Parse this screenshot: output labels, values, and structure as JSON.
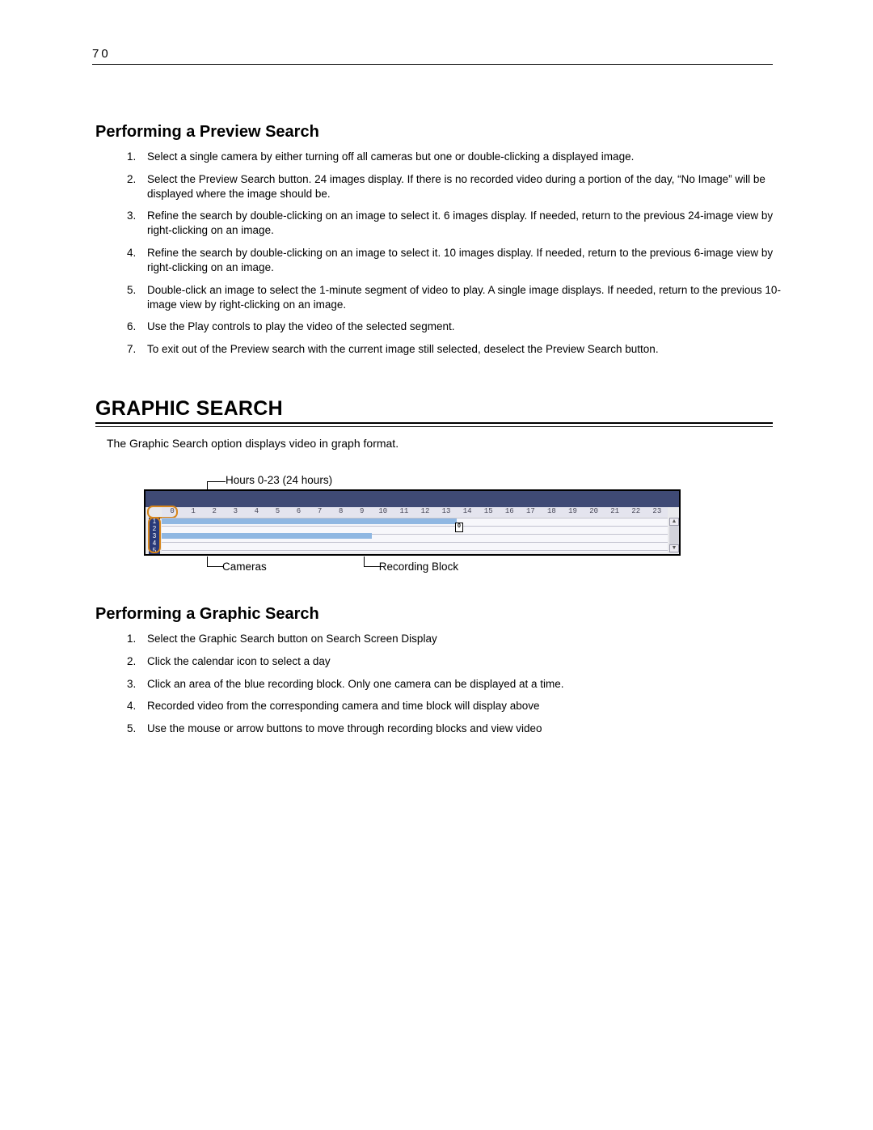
{
  "page_number": "70",
  "sections": {
    "preview": {
      "heading": "Performing a Preview Search",
      "steps": [
        "Select a single camera by either turning off all cameras but one or double-clicking a displayed image.",
        "Select the Preview Search button.  24 images display.  If there is no recorded video during a portion of the day, “No Image” will be displayed where the image should be.",
        "Refine the search by double-clicking on an image to select it.  6 images display. If needed, return to the previous 24-image view by right-clicking on an image.",
        "Refine the search by double-clicking on an image to select it.  10 images display. If needed, return to the previous 6-image view by right-clicking on an image.",
        "Double-click an image to select the 1-minute segment of video to play.  A single image displays.  If needed, return to the previous 10-image view by right-clicking on an image.",
        "Use the Play controls to play the video of the selected segment.",
        "To exit out of the Preview search with the current image still selected, deselect the Preview Search button."
      ]
    },
    "graphic": {
      "heading": "GRAPHIC SEARCH",
      "intro": "The Graphic Search option displays video in graph format.",
      "annotations": {
        "hours": "Hours 0-23 (24 hours)",
        "cameras": "Cameras",
        "recording_block": "Recording Block"
      },
      "hours": [
        "0",
        "1",
        "2",
        "3",
        "4",
        "5",
        "6",
        "7",
        "8",
        "9",
        "10",
        "11",
        "12",
        "13",
        "14",
        "15",
        "16",
        "17",
        "18",
        "19",
        "20",
        "21",
        "22",
        "23"
      ],
      "cameras": [
        "1",
        "2",
        "3",
        "4",
        "5"
      ],
      "marker_label": "0"
    },
    "graphic_steps": {
      "heading": "Performing a Graphic Search",
      "steps": [
        "Select the Graphic Search button on Search Screen Display",
        "Click the calendar icon to select a day",
        "Click an area of the blue recording block. Only one camera can be displayed at a time.",
        "Recorded video from the corresponding camera and time block will display above",
        "Use the mouse or arrow buttons to move through recording blocks and view video"
      ]
    }
  }
}
